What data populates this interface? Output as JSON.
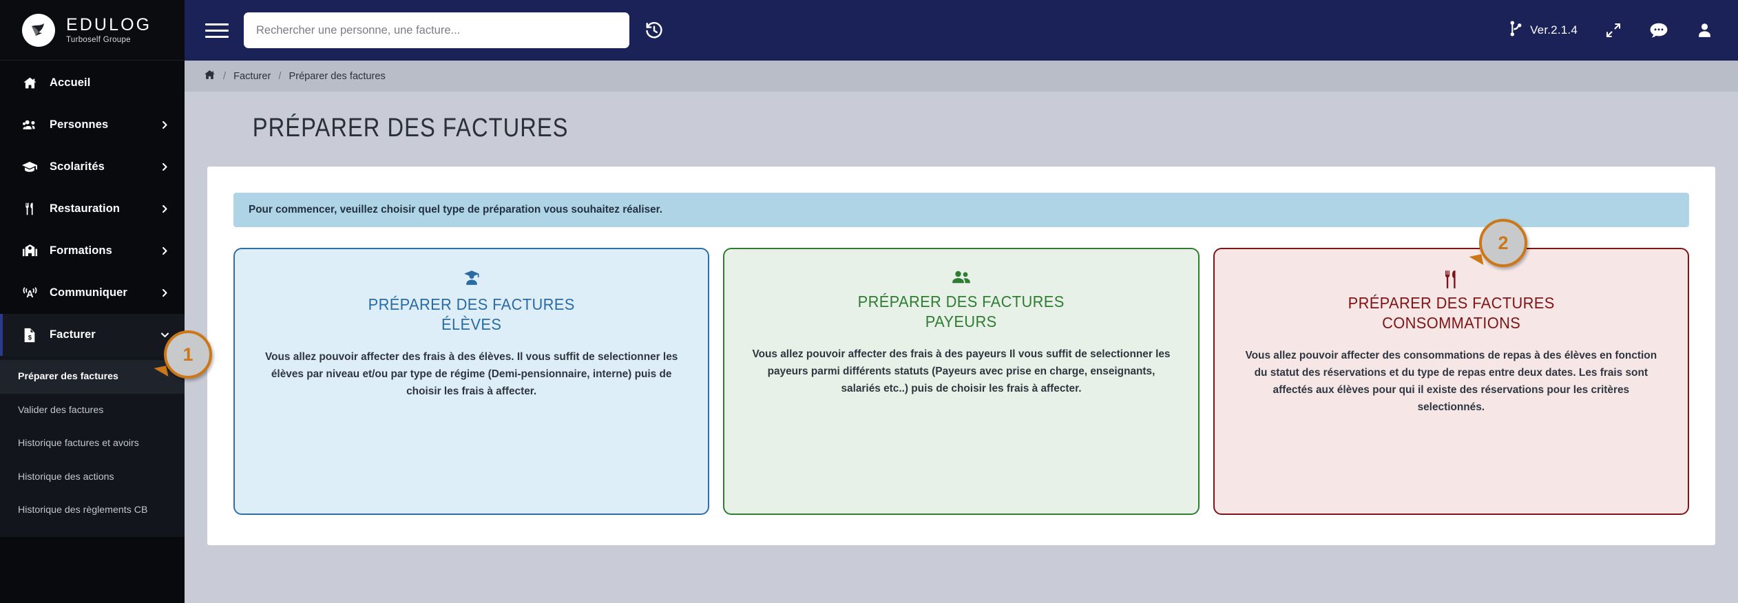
{
  "brand": {
    "title": "EDULOG",
    "subtitle": "Turboself Groupe",
    "logo_icon": "bird-icon"
  },
  "sidebar": {
    "items": [
      {
        "label": "Accueil",
        "icon": "home-icon",
        "chevron": false,
        "active": false
      },
      {
        "label": "Personnes",
        "icon": "users-icon",
        "chevron": true,
        "active": false
      },
      {
        "label": "Scolarités",
        "icon": "graduation-cap-icon",
        "chevron": true,
        "active": false
      },
      {
        "label": "Restauration",
        "icon": "cutlery-icon",
        "chevron": true,
        "active": false
      },
      {
        "label": "Formations",
        "icon": "school-icon",
        "chevron": true,
        "active": false
      },
      {
        "label": "Communiquer",
        "icon": "broadcast-icon",
        "chevron": true,
        "active": false
      },
      {
        "label": "Facturer",
        "icon": "invoice-icon",
        "chevron": true,
        "active": true
      }
    ],
    "submenu": [
      {
        "label": "Préparer des factures",
        "active": true
      },
      {
        "label": "Valider des factures",
        "active": false
      },
      {
        "label": "Historique factures et avoirs",
        "active": false
      },
      {
        "label": "Historique des actions",
        "active": false
      },
      {
        "label": "Historique des règlements CB",
        "active": false
      }
    ]
  },
  "topbar": {
    "menu_icon": "hamburger-icon",
    "search": {
      "value": "",
      "placeholder": "Rechercher une personne, une facture..."
    },
    "history_icon": "history-icon",
    "version_icon": "git-branch-icon",
    "version": "Ver.2.1.4",
    "expand_icon": "expand-arrows-icon",
    "chat_icon": "chat-bubble-icon",
    "user_icon": "user-icon"
  },
  "breadcrumb": {
    "home_icon": "home-icon",
    "items": [
      "Facturer",
      "Préparer des factures"
    ],
    "separator": "/"
  },
  "page": {
    "title": "PRÉPARER DES FACTURES",
    "info_banner": "Pour commencer, veuillez choisir quel type de préparation vous souhaitez réaliser."
  },
  "cards": [
    {
      "icon": "student-cap-person-icon",
      "title_line1": "PRÉPARER DES FACTURES",
      "title_line2": "ÉLÈVES",
      "description": "Vous allez pouvoir affecter des frais à des élèves. Il vous suffit de selectionner les élèves par niveau et/ou par type de régime (Demi-pensionnaire, interne) puis de choisir les frais à affecter.",
      "color": "#2a6ba3",
      "background": "#ddeef8"
    },
    {
      "icon": "two-people-icon",
      "title_line1": "PRÉPARER DES FACTURES",
      "title_line2": "PAYEURS",
      "description": "Vous allez pouvoir affecter des frais à des payeurs Il vous suffit de selectionner les payeurs parmi différents statuts (Payeurs avec prise en charge, enseignants, salariés etc..) puis de choisir les frais à affecter.",
      "color": "#2f7d32",
      "background": "#e7f1e7"
    },
    {
      "icon": "cutlery-icon",
      "title_line1": "PRÉPARER DES FACTURES",
      "title_line2": "CONSOMMATIONS",
      "description": "Vous allez pouvoir affecter des consommations de repas à des élèves en fonction du statut des réservations et du type de repas entre deux dates. Les frais sont affectés aux élèves pour qui il existe des réservations pour les critères selectionnés.",
      "color": "#7e1416",
      "background": "#f6e6e6"
    }
  ],
  "callouts": [
    {
      "number": "1",
      "color": "#cc7718"
    },
    {
      "number": "2",
      "color": "#cc7718"
    }
  ]
}
